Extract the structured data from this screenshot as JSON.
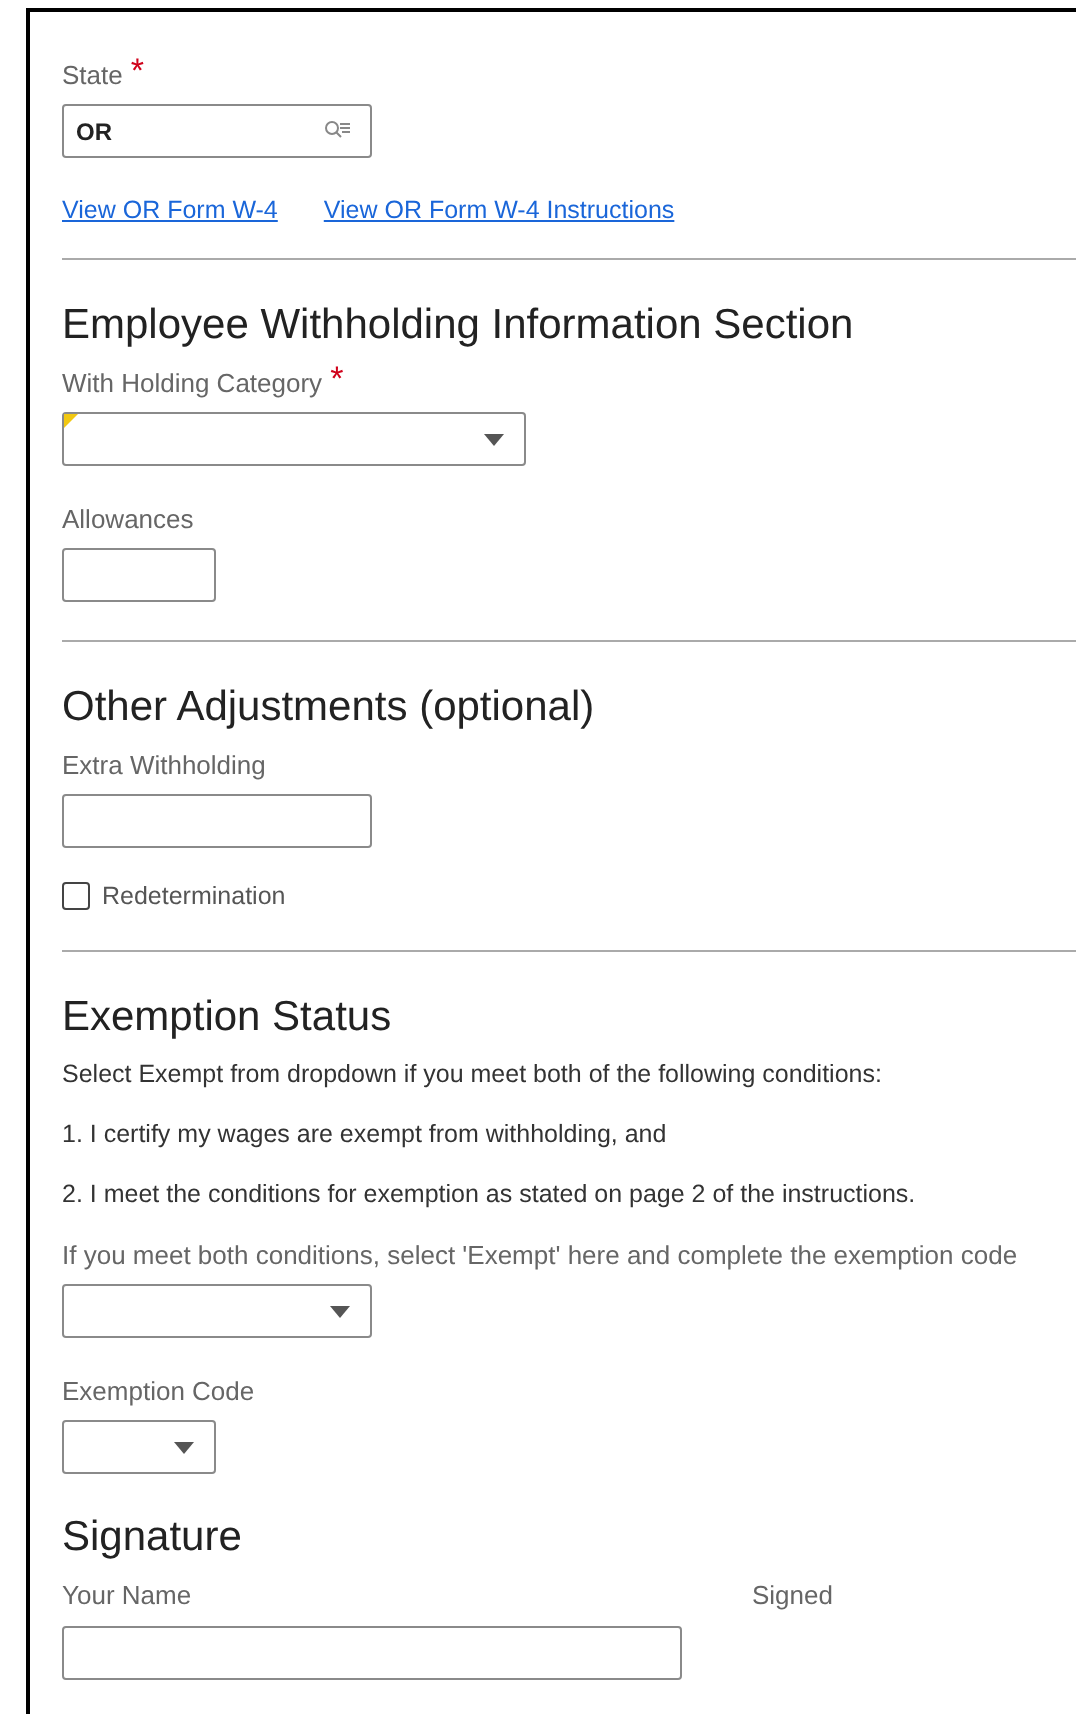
{
  "blocks": [
    {
      "kind": "lookup",
      "label": "State",
      "required_mark": "*",
      "value": "OR"
    },
    {
      "kind": "links",
      "links": [
        "View OR Form W-4",
        "View OR Form W-4 Instructions"
      ]
    },
    {
      "kind": "divider"
    },
    {
      "kind": "heading",
      "text": "Employee Withholding Information Section"
    },
    {
      "kind": "select",
      "label": "With Holding Category",
      "required_mark": "*",
      "flagged": true
    },
    {
      "kind": "input",
      "label": "Allowances"
    },
    {
      "kind": "divider"
    },
    {
      "kind": "heading",
      "text": "Other Adjustments (optional)"
    },
    {
      "kind": "input",
      "label": "Extra Withholding"
    },
    {
      "kind": "checkbox",
      "label": "Redetermination",
      "checked": false
    },
    {
      "kind": "divider"
    },
    {
      "kind": "heading",
      "text": "Exemption Status"
    },
    {
      "kind": "text",
      "text": "Select Exempt from dropdown if you meet both of the following conditions:"
    },
    {
      "kind": "text",
      "text": "1. I certify my wages are exempt from withholding, and"
    },
    {
      "kind": "text",
      "text": "2. I meet the conditions for exemption as stated on page 2 of the instructions."
    },
    {
      "kind": "select",
      "label": "If you meet both conditions, select 'Exempt' here and complete the exemption code",
      "flagged": false
    },
    {
      "kind": "select",
      "label": "Exemption Code",
      "flagged": false
    },
    {
      "kind": "heading",
      "text": "Signature"
    },
    {
      "kind": "signature",
      "label": "Your Name",
      "side_label": "Signed"
    }
  ]
}
